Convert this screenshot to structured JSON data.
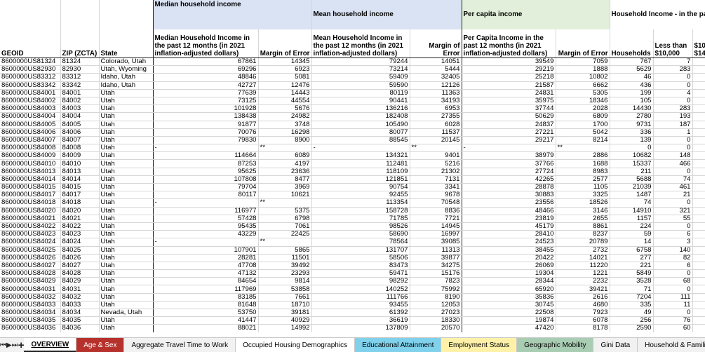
{
  "headers": {
    "geoid": "GEOID",
    "zip": "ZIP (ZCTA)",
    "state": "State",
    "g_median": "Median household income",
    "g_mean": "Mean household income",
    "g_percap": "Per capita income",
    "g_hh": "Household Income - in the pa",
    "median_income": "Median Household Income in the past 12 months (in 2021 inflation-adjusted dollars)",
    "moe1": "Margin of Error",
    "mean_income": "Mean Household Income in the past 12 months (in 2021 inflation-adjusted dollars)",
    "moe2": "Margin of Error",
    "percap_income": "Per Capita Income in the past 12 months (in 2021 inflation-adjusted dollars)",
    "moe3": "Margin of Error",
    "households": "Households",
    "lt10k": "Less than $10,000",
    "next": "$10 $14"
  },
  "rows": [
    [
      "8600000US81324",
      "81324",
      "Colorado, Utah",
      "67861",
      "14345",
      "79244",
      "14051",
      "39549",
      "7059",
      "767",
      "7"
    ],
    [
      "8600000US82930",
      "82930",
      "Utah, Wyoming",
      "69296",
      "6923",
      "73214",
      "5444",
      "29219",
      "1888",
      "5629",
      "283"
    ],
    [
      "8600000US83312",
      "83312",
      "Idaho, Utah",
      "48846",
      "5081",
      "59409",
      "32405",
      "25218",
      "10802",
      "46",
      "0"
    ],
    [
      "8600000US83342",
      "83342",
      "Idaho, Utah",
      "42727",
      "12476",
      "59590",
      "12126",
      "21587",
      "6662",
      "436",
      "0"
    ],
    [
      "8600000US84001",
      "84001",
      "Utah",
      "77639",
      "14443",
      "80119",
      "11363",
      "24831",
      "5305",
      "199",
      "4"
    ],
    [
      "8600000US84002",
      "84002",
      "Utah",
      "73125",
      "44554",
      "90441",
      "34193",
      "35975",
      "18346",
      "105",
      "0"
    ],
    [
      "8600000US84003",
      "84003",
      "Utah",
      "101928",
      "5676",
      "136216",
      "6953",
      "37744",
      "2028",
      "14430",
      "283"
    ],
    [
      "8600000US84004",
      "84004",
      "Utah",
      "138438",
      "24982",
      "182408",
      "27355",
      "50629",
      "6809",
      "2780",
      "193"
    ],
    [
      "8600000US84005",
      "84005",
      "Utah",
      "91877",
      "3748",
      "105490",
      "6028",
      "24837",
      "1700",
      "9731",
      "187"
    ],
    [
      "8600000US84006",
      "84006",
      "Utah",
      "70076",
      "16298",
      "80077",
      "11537",
      "27221",
      "5042",
      "336",
      "1"
    ],
    [
      "8600000US84007",
      "84007",
      "Utah",
      "79830",
      "8900",
      "88545",
      "20145",
      "29217",
      "8214",
      "139",
      "0"
    ],
    [
      "8600000US84008",
      "84008",
      "Utah",
      "-",
      "**",
      "-",
      "**",
      "-",
      "**",
      "0",
      "0"
    ],
    [
      "8600000US84009",
      "84009",
      "Utah",
      "114664",
      "6089",
      "134321",
      "9401",
      "38979",
      "2886",
      "10682",
      "148"
    ],
    [
      "8600000US84010",
      "84010",
      "Utah",
      "87253",
      "4197",
      "112481",
      "5216",
      "37766",
      "1688",
      "15337",
      "466"
    ],
    [
      "8600000US84013",
      "84013",
      "Utah",
      "95625",
      "23636",
      "118109",
      "21302",
      "27724",
      "8983",
      "211",
      "0"
    ],
    [
      "8600000US84014",
      "84014",
      "Utah",
      "107808",
      "8477",
      "121851",
      "7131",
      "42265",
      "2577",
      "5688",
      "74"
    ],
    [
      "8600000US84015",
      "84015",
      "Utah",
      "79704",
      "3969",
      "90754",
      "3341",
      "28878",
      "1105",
      "21039",
      "461"
    ],
    [
      "8600000US84017",
      "84017",
      "Utah",
      "80117",
      "10621",
      "92455",
      "9678",
      "30883",
      "3325",
      "1487",
      "21"
    ],
    [
      "8600000US84018",
      "84018",
      "Utah",
      "-",
      "**",
      "113354",
      "70548",
      "23556",
      "18526",
      "74",
      "0"
    ],
    [
      "8600000US84020",
      "84020",
      "Utah",
      "116977",
      "5375",
      "158728",
      "8836",
      "48466",
      "3146",
      "14910",
      "321"
    ],
    [
      "8600000US84021",
      "84021",
      "Utah",
      "57428",
      "6798",
      "71785",
      "7721",
      "23819",
      "2655",
      "1157",
      "55"
    ],
    [
      "8600000US84022",
      "84022",
      "Utah",
      "95435",
      "7061",
      "98526",
      "14945",
      "45179",
      "8861",
      "224",
      "0"
    ],
    [
      "8600000US84023",
      "84023",
      "Utah",
      "43229",
      "22425",
      "58690",
      "16997",
      "28410",
      "8237",
      "59",
      "6"
    ],
    [
      "8600000US84024",
      "84024",
      "Utah",
      "-",
      "**",
      "78564",
      "39085",
      "24523",
      "20789",
      "14",
      "3"
    ],
    [
      "8600000US84025",
      "84025",
      "Utah",
      "107901",
      "5865",
      "131707",
      "11313",
      "38455",
      "2732",
      "6758",
      "140"
    ],
    [
      "8600000US84026",
      "84026",
      "Utah",
      "28281",
      "11501",
      "58506",
      "39877",
      "20422",
      "14021",
      "277",
      "82"
    ],
    [
      "8600000US84027",
      "84027",
      "Utah",
      "47708",
      "39492",
      "83473",
      "34275",
      "26069",
      "11220",
      "221",
      "6"
    ],
    [
      "8600000US84028",
      "84028",
      "Utah",
      "47132",
      "23293",
      "59471",
      "15176",
      "19304",
      "1221",
      "5849",
      "0"
    ],
    [
      "8600000US84029",
      "84029",
      "Utah",
      "84654",
      "9814",
      "98292",
      "7823",
      "28344",
      "2232",
      "3528",
      "68"
    ],
    [
      "8600000US84031",
      "84031",
      "Utah",
      "117969",
      "53858",
      "140252",
      "75992",
      "65920",
      "39421",
      "71",
      "0"
    ],
    [
      "8600000US84032",
      "84032",
      "Utah",
      "83185",
      "7661",
      "111766",
      "8190",
      "35836",
      "2616",
      "7204",
      "111"
    ],
    [
      "8600000US84033",
      "84033",
      "Utah",
      "81648",
      "18710",
      "93455",
      "12053",
      "30745",
      "4680",
      "335",
      "11"
    ],
    [
      "8600000US84034",
      "84034",
      "Nevada, Utah",
      "53750",
      "39181",
      "61392",
      "27023",
      "22508",
      "7923",
      "49",
      "0"
    ],
    [
      "8600000US84035",
      "84035",
      "Utah",
      "41447",
      "40929",
      "36619",
      "18330",
      "19874",
      "6078",
      "256",
      "76"
    ],
    [
      "8600000US84036",
      "84036",
      "Utah",
      "88021",
      "14992",
      "137809",
      "20570",
      "47420",
      "8178",
      "2590",
      "60"
    ]
  ],
  "tabs": [
    {
      "label": "OVERVIEW",
      "color": "",
      "active": true
    },
    {
      "label": "Age & Sex",
      "color": "#b7312c",
      "text": "#ffffff"
    },
    {
      "label": "Aggregate Travel Time to Work",
      "color": "",
      "text": ""
    },
    {
      "label": "Occupied Housing Demographics",
      "color": "#ffffff",
      "text": ""
    },
    {
      "label": "Educational Attainment",
      "color": "#7fd1ec",
      "text": ""
    },
    {
      "label": "Employment Status",
      "color": "#fff2a8",
      "text": ""
    },
    {
      "label": "Geographic Mobility",
      "color": "#a9cdb3",
      "text": ""
    },
    {
      "label": "Gini Data",
      "color": "",
      "text": ""
    },
    {
      "label": "Household & Families",
      "color": "",
      "text": ""
    }
  ],
  "nav": {
    "first": "⏮",
    "prev": "◀",
    "next": "▶",
    "last": "⏭",
    "add": "+"
  }
}
